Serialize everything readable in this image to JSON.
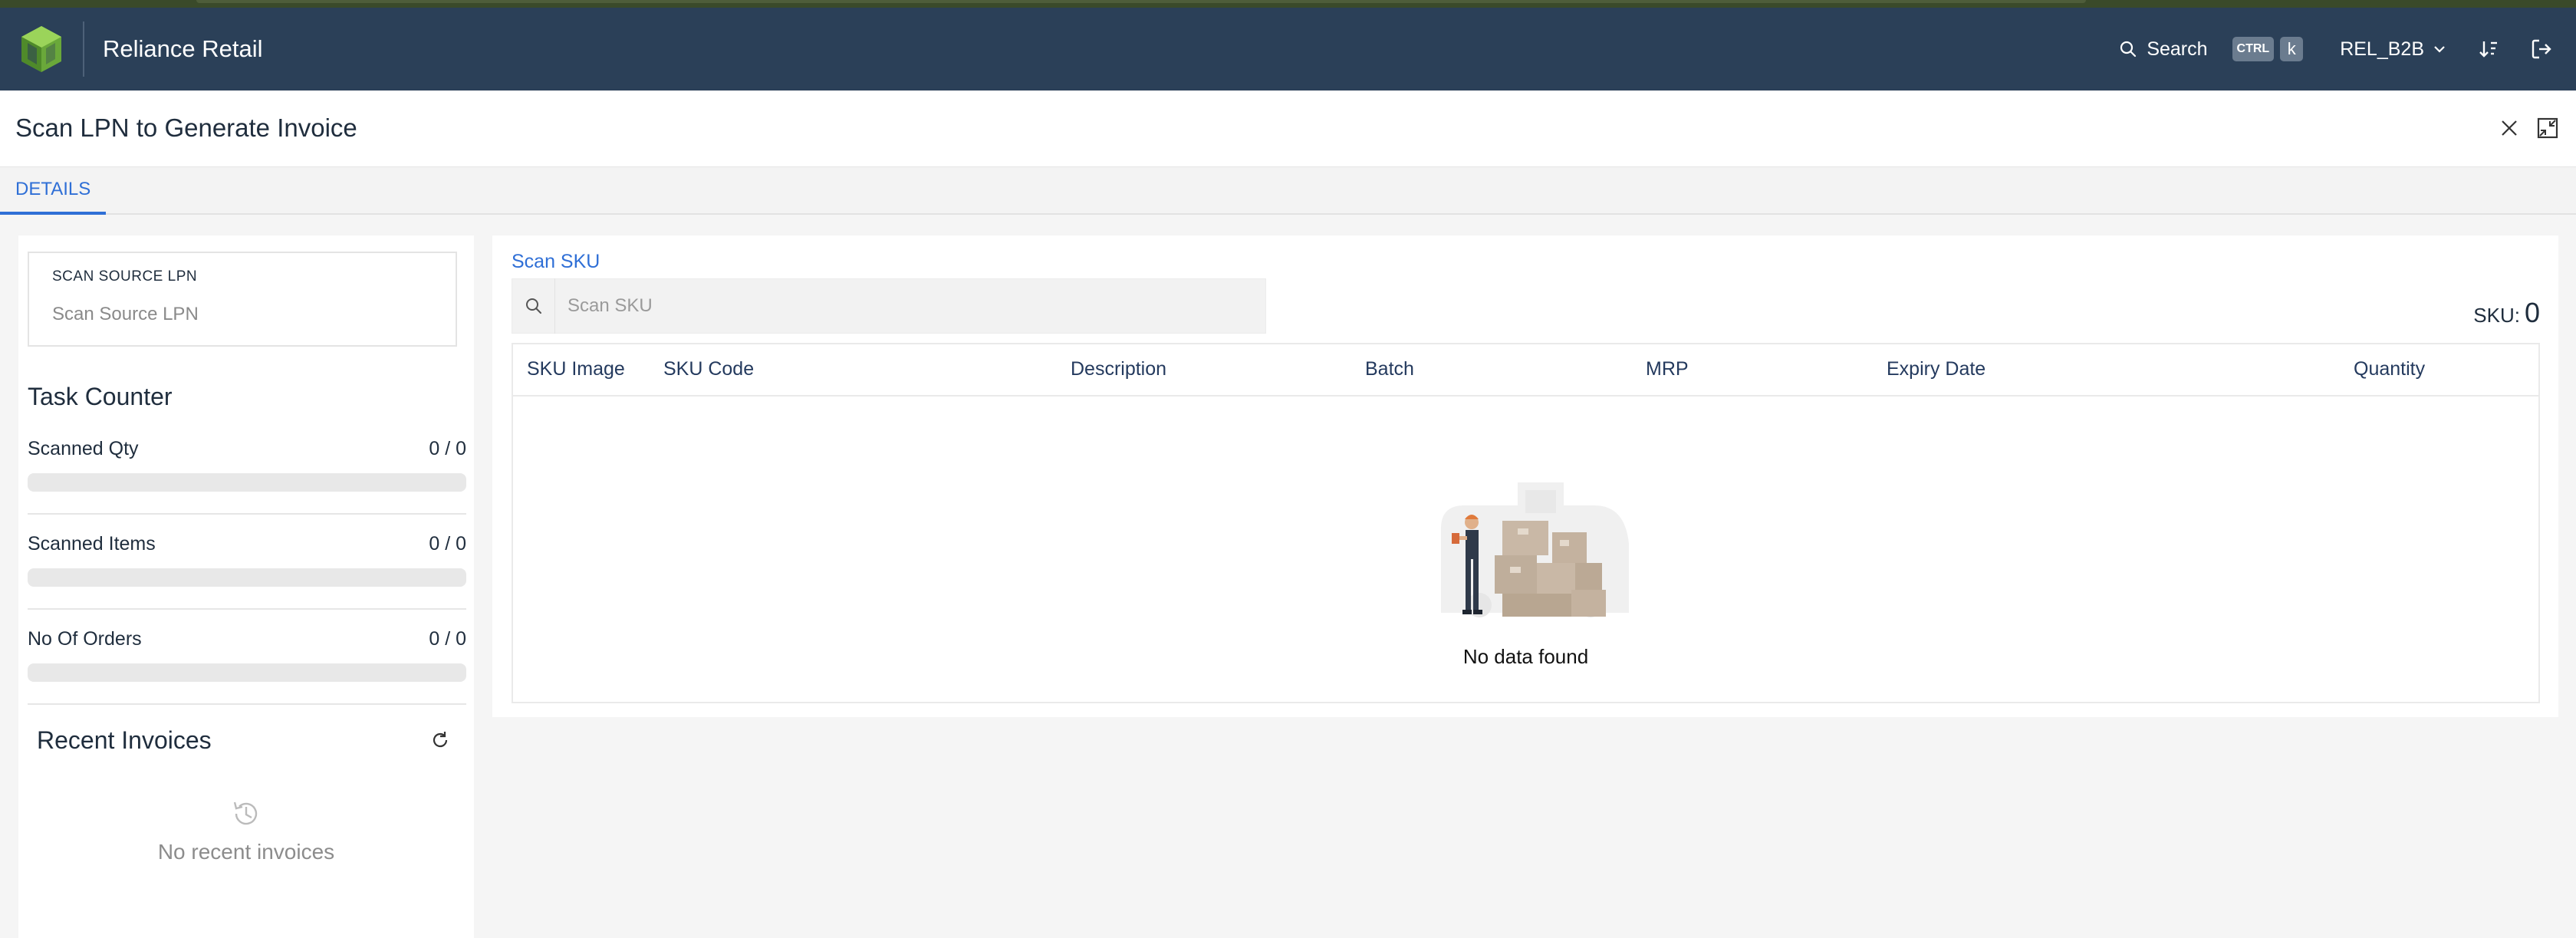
{
  "app": {
    "title": "Reliance Retail",
    "search_label": "Search",
    "shortcut_ctrl": "CTRL",
    "shortcut_k": "k",
    "tenant": "REL_B2B"
  },
  "header": {
    "title": "Scan LPN to Generate Invoice"
  },
  "tabs": [
    {
      "label": "DETAILS",
      "active": true
    }
  ],
  "left": {
    "lpn_label": "SCAN SOURCE LPN",
    "lpn_placeholder": "Scan Source LPN",
    "task_counter_title": "Task Counter",
    "counters": [
      {
        "label": "Scanned Qty",
        "value": "0 / 0",
        "progress": 0
      },
      {
        "label": "Scanned Items",
        "value": "0 / 0",
        "progress": 0
      },
      {
        "label": "No Of Orders",
        "value": "0 / 0",
        "progress": 0
      }
    ],
    "recent_title": "Recent Invoices",
    "recent_empty": "No recent invoices"
  },
  "main": {
    "scan_label": "Scan SKU",
    "scan_placeholder": "Scan SKU",
    "sku_label": "SKU:",
    "sku_count": "0",
    "columns": [
      "SKU Image",
      "SKU Code",
      "Description",
      "Batch",
      "MRP",
      "Expiry Date",
      "Quantity"
    ],
    "empty_text": "No data found"
  },
  "colors": {
    "navbar": "#2b4058",
    "accent": "#2f6fd6",
    "logo_green": "#7bbf3f"
  }
}
